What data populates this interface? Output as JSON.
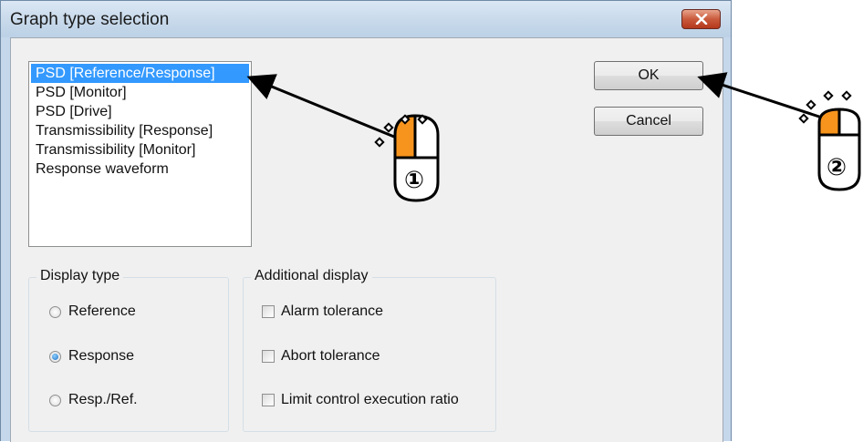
{
  "window": {
    "title": "Graph type selection",
    "close_icon": "close-icon",
    "accent_color": "#3399ff"
  },
  "graph_list": {
    "items": [
      {
        "label": "PSD [Reference/Response]",
        "selected": true
      },
      {
        "label": "PSD [Monitor]",
        "selected": false
      },
      {
        "label": "PSD [Drive]",
        "selected": false
      },
      {
        "label": "Transmissibility [Response]",
        "selected": false
      },
      {
        "label": "Transmissibility [Monitor]",
        "selected": false
      },
      {
        "label": "Response waveform",
        "selected": false
      }
    ]
  },
  "buttons": {
    "ok_label": "OK",
    "cancel_label": "Cancel"
  },
  "display_type": {
    "label": "Display type",
    "options": [
      {
        "label": "Reference",
        "checked": false
      },
      {
        "label": "Response",
        "checked": true
      },
      {
        "label": "Resp./Ref.",
        "checked": false
      }
    ]
  },
  "additional_display": {
    "label": "Additional display",
    "options": [
      {
        "label": "Alarm tolerance",
        "checked": false
      },
      {
        "label": "Abort tolerance",
        "checked": false
      },
      {
        "label": "Limit control execution ratio",
        "checked": false
      }
    ]
  },
  "annotations": {
    "step1_marker": "①",
    "step2_marker": "②",
    "mouse_icon": "mouse-left-click-icon",
    "highlight_color": "#f7941d"
  }
}
